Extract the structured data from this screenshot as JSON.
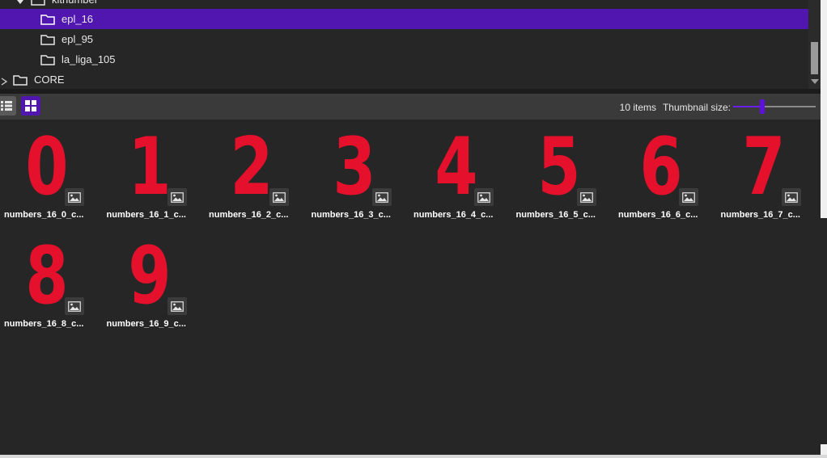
{
  "tree": {
    "rows": [
      {
        "label": "kitnumber",
        "kind": "folder-expanded"
      },
      {
        "label": "epl_16",
        "kind": "folder",
        "selected": true
      },
      {
        "label": "epl_95",
        "kind": "folder"
      },
      {
        "label": "la_liga_105",
        "kind": "folder"
      },
      {
        "label": "CORE",
        "kind": "folder-collapsed"
      }
    ]
  },
  "toolbar": {
    "item_count": "10 items",
    "thumbnail_size_label": "Thumbnail size:",
    "thumbnail_size_level": 0.35
  },
  "grid": {
    "items": [
      {
        "glyph": "0",
        "label": "numbers_16_0_c..."
      },
      {
        "glyph": "1",
        "label": "numbers_16_1_c..."
      },
      {
        "glyph": "2",
        "label": "numbers_16_2_c..."
      },
      {
        "glyph": "3",
        "label": "numbers_16_3_c..."
      },
      {
        "glyph": "4",
        "label": "numbers_16_4_c..."
      },
      {
        "glyph": "5",
        "label": "numbers_16_5_c..."
      },
      {
        "glyph": "6",
        "label": "numbers_16_6_c..."
      },
      {
        "glyph": "7",
        "label": "numbers_16_7_c..."
      },
      {
        "glyph": "8",
        "label": "numbers_16_8_c..."
      },
      {
        "glyph": "9",
        "label": "numbers_16_9_c..."
      }
    ]
  },
  "colors": {
    "selection": "#5116b0",
    "accent": "#5d10e0",
    "digit_red": "#e5102b",
    "background": "#262626"
  },
  "icons": [
    "folder-icon",
    "caret-down-icon",
    "caret-right-icon",
    "list-view-icon",
    "grid-view-icon",
    "image-icon"
  ]
}
